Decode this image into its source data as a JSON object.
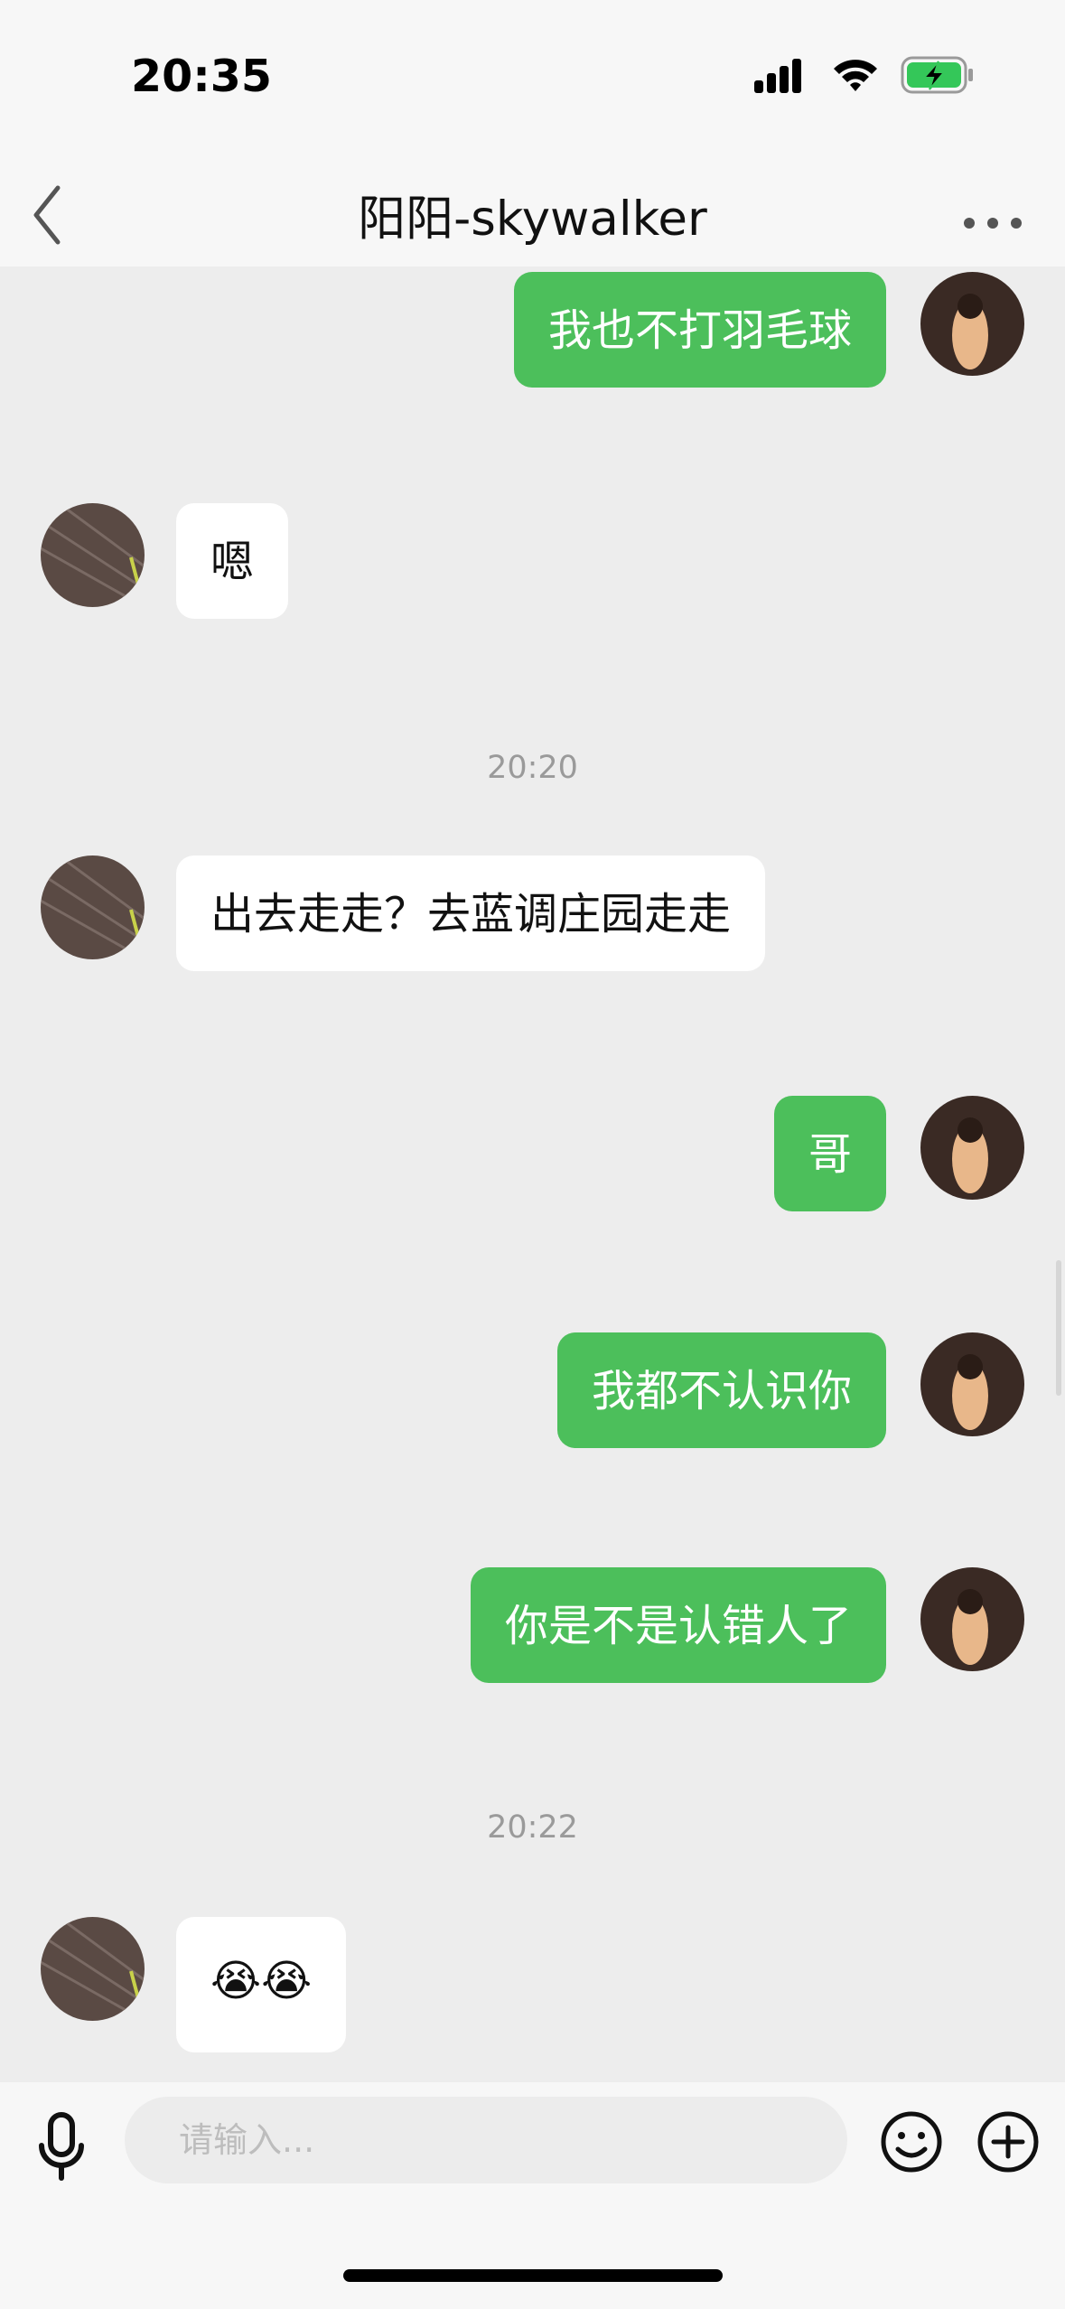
{
  "status": {
    "time": "20:35"
  },
  "header": {
    "title": "阳阳-skywalker"
  },
  "messages": [
    {
      "side": "me",
      "text": "我也不打羽毛球"
    },
    {
      "side": "them",
      "text": "嗯"
    },
    {
      "type": "timestamp",
      "text": "20:20"
    },
    {
      "side": "them",
      "text": "出去走走？去蓝调庄园走走"
    },
    {
      "side": "me",
      "text": "哥"
    },
    {
      "side": "me",
      "text": "我都不认识你"
    },
    {
      "side": "me",
      "text": "你是不是认错人了"
    },
    {
      "type": "timestamp",
      "text": "20:22"
    },
    {
      "side": "them",
      "text": "😭😭"
    }
  ],
  "input": {
    "placeholder": "请输入..."
  },
  "colors": {
    "my_bubble": "#4cbf5b",
    "their_bubble": "#ffffff",
    "background": "#ededed",
    "battery": "#34c759"
  },
  "icons": [
    "back-icon",
    "more-icon",
    "signal-icon",
    "wifi-icon",
    "battery-icon",
    "mic-icon",
    "emoji-icon",
    "plus-icon"
  ]
}
